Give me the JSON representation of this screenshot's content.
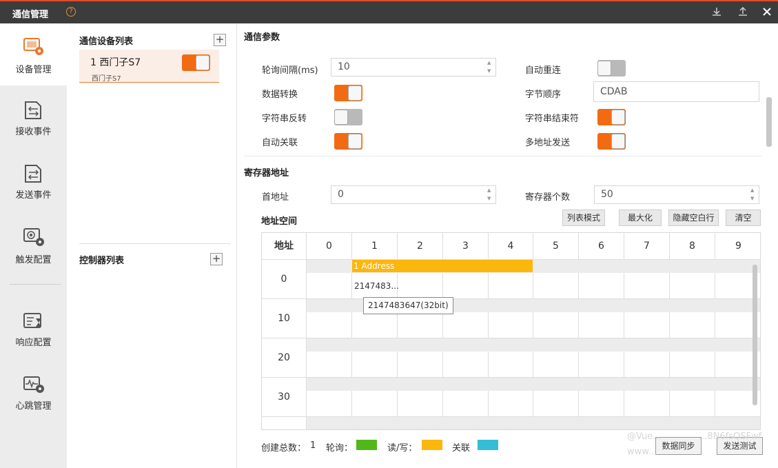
{
  "window": {
    "title": "通信管理",
    "help_icon": "question-circle-icon",
    "buttons": [
      "import-icon",
      "export-icon",
      "close-icon"
    ]
  },
  "sidebar": {
    "items": [
      {
        "label": "设备管理",
        "icon": "device-settings-icon",
        "active": true
      },
      {
        "label": "接收事件",
        "icon": "receive-event-icon",
        "active": false
      },
      {
        "label": "发送事件",
        "icon": "send-event-icon",
        "active": false
      },
      {
        "label": "触发配置",
        "icon": "trigger-settings-icon",
        "active": false
      },
      {
        "label": "响应配置",
        "icon": "response-config-icon",
        "active": false
      },
      {
        "label": "心跳管理",
        "icon": "heartbeat-settings-icon",
        "active": false
      }
    ]
  },
  "device_list": {
    "title": "通信设备列表",
    "devices": [
      {
        "name": "1 西门子S7",
        "sub": "西门子S7",
        "enabled": true
      }
    ]
  },
  "controller_list": {
    "title": "控制器列表"
  },
  "params": {
    "title": "通信参数",
    "poll_interval_label": "轮询间隔(ms)",
    "poll_interval_value": "10",
    "auto_reconnect_label": "自动重连",
    "auto_reconnect": false,
    "data_convert_label": "数据转换",
    "data_convert": true,
    "byte_order_label": "字节顺序",
    "byte_order_value": "CDAB",
    "string_reverse_label": "字符串反转",
    "string_reverse": false,
    "string_terminator_label": "字符串结束符",
    "string_terminator": true,
    "auto_link_label": "自动关联",
    "auto_link": true,
    "multi_addr_label": "多地址发送",
    "multi_addr": true
  },
  "register": {
    "title": "寄存器地址",
    "start_label": "首地址",
    "start_value": "0",
    "count_label": "寄存器个数",
    "count_value": "50",
    "space_label": "地址空间",
    "buttons": {
      "list_mode": "列表模式",
      "maximize": "最大化",
      "hide_empty": "隐藏空白行",
      "clear": "清空"
    },
    "grid": {
      "header_label": "地址",
      "columns": [
        "0",
        "1",
        "2",
        "3",
        "4",
        "5",
        "6",
        "7",
        "8",
        "9"
      ],
      "rows": [
        "0",
        "10",
        "20",
        "30"
      ],
      "bar_label": "1 Address",
      "cell_value": "2147483...",
      "tooltip": "2147483647(32bit)"
    }
  },
  "footer": {
    "total_label": "创建总数：",
    "total_value": "1",
    "legend": [
      {
        "label": "轮询：",
        "color": "#52b81a"
      },
      {
        "label": "读/写：",
        "color": "#fcb70c"
      },
      {
        "label": "关联",
        "color": "#36bcd4"
      }
    ],
    "sync_button": "数据同步",
    "send_test_button": "发送测试",
    "watermark1": "@Vue...",
    "watermark2": "...8N6fsQSFwf",
    "watermark3": "www..."
  }
}
